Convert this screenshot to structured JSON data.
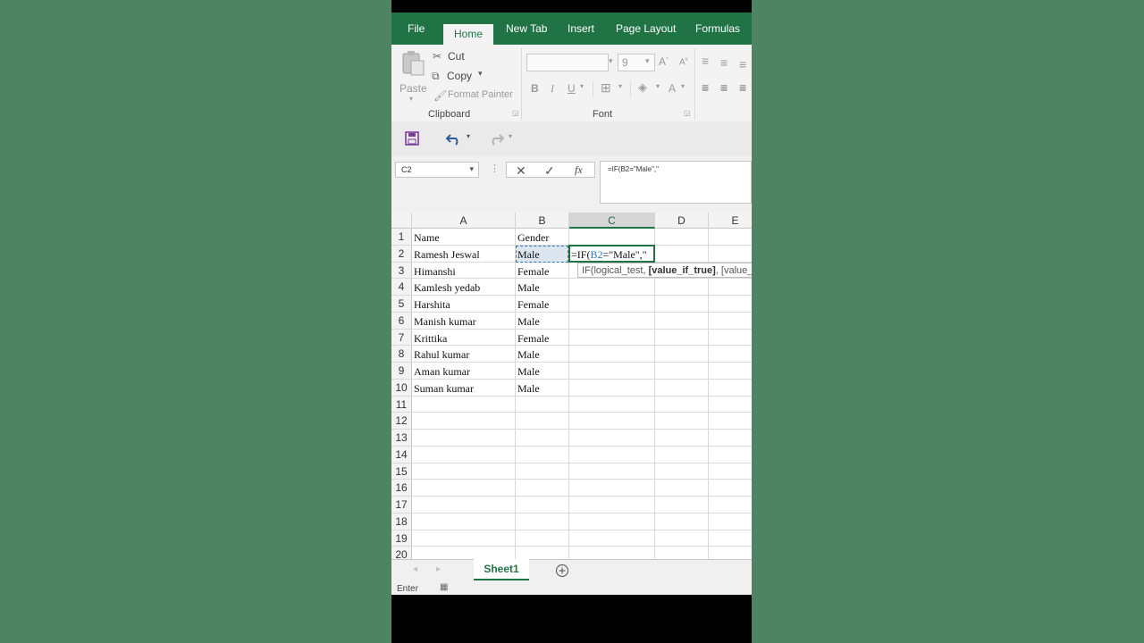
{
  "ribbon": {
    "tabs": [
      "File",
      "Home",
      "New Tab",
      "Insert",
      "Page Layout",
      "Formulas"
    ],
    "active_tab": "Home",
    "clipboard": {
      "paste": "Paste",
      "cut": "Cut",
      "copy": "Copy",
      "format_painter": "Format Painter",
      "group_label": "Clipboard"
    },
    "font": {
      "size": "9",
      "group_label": "Font",
      "bold": "B",
      "italic": "I",
      "underline": "U"
    }
  },
  "formula_bar": {
    "name_box": "C2",
    "fx_label": "fx",
    "formula": "=IF(B2=\"Male\",\""
  },
  "grid": {
    "columns": [
      "A",
      "B",
      "C",
      "D",
      "E"
    ],
    "selected_column": "C",
    "row_numbers": [
      "1",
      "2",
      "3",
      "4",
      "5",
      "6",
      "7",
      "8",
      "9",
      "10",
      "11",
      "12",
      "13",
      "14",
      "15",
      "16",
      "17",
      "18",
      "19",
      "20"
    ],
    "rows": [
      {
        "a": "Name",
        "b": "Gender"
      },
      {
        "a": "Ramesh Jeswal",
        "b": "Male"
      },
      {
        "a": "Himanshi",
        "b": "Female"
      },
      {
        "a": "Kamlesh yedab",
        "b": "Male"
      },
      {
        "a": "Harshita",
        "b": "Female"
      },
      {
        "a": "Manish kumar",
        "b": "Male"
      },
      {
        "a": "Krittika",
        "b": "Female"
      },
      {
        "a": "Rahul kumar",
        "b": "Male"
      },
      {
        "a": "Aman kumar",
        "b": "Male"
      },
      {
        "a": "Suman kumar",
        "b": "Male"
      }
    ],
    "active_cell_edit": {
      "prefix": "=IF(",
      "ref": "B2",
      "suffix": "=\"Male\",\""
    },
    "tooltip": {
      "start": "IF(logical_test, ",
      "bold": "[value_if_true]",
      "end": ", [value_if_false])"
    }
  },
  "sheets": {
    "active": "Sheet1"
  },
  "status": {
    "mode": "Enter"
  },
  "colors": {
    "accent": "#217346",
    "background": "#4e8461",
    "ref_blue": "#2f75b5"
  }
}
